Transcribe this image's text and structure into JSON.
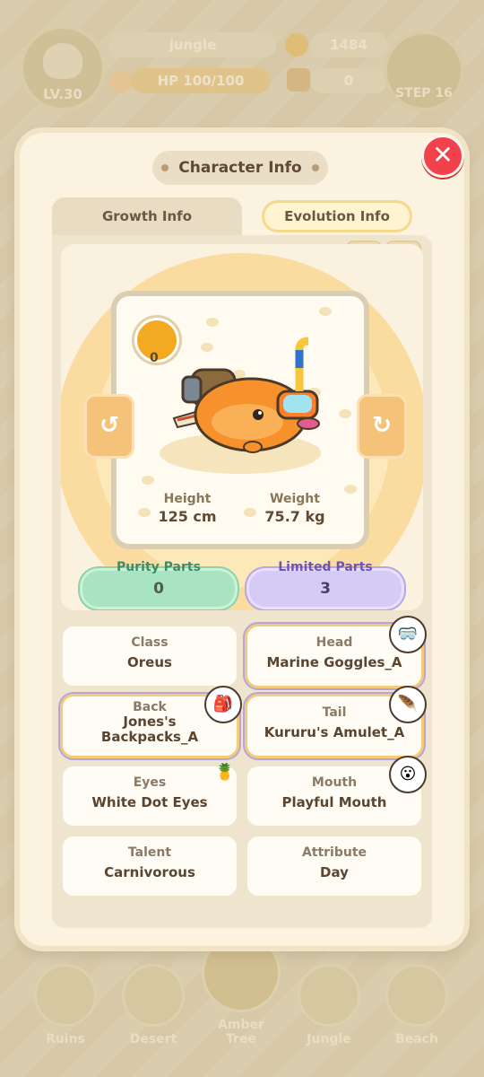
{
  "hud": {
    "level": "LV.30",
    "area": "jungle",
    "coins": "1484",
    "hp": "HP 100/100",
    "tickets": "0",
    "step": "STEP 16"
  },
  "modal": {
    "title": "Character Info",
    "close_icon": "close-icon",
    "tabs": {
      "growth": "Growth Info",
      "evolution": "Evolution Info"
    },
    "buffs": [
      "meat-icon",
      "sun-icon"
    ],
    "character": {
      "orange_count": "0",
      "height_label": "Height",
      "height_value": "125 cm",
      "weight_label": "Weight",
      "weight_value": "75.7 kg"
    },
    "parts": {
      "purity_label": "Purity Parts",
      "purity_value": "0",
      "limited_label": "Limited Parts",
      "limited_value": "3"
    },
    "attributes": [
      {
        "key": "Class",
        "value": "Oreus"
      },
      {
        "key": "Head",
        "value": "Marine Goggles_A"
      },
      {
        "key": "Back",
        "value": "Jones's Backpacks_A"
      },
      {
        "key": "Tail",
        "value": "Kururu's Amulet_A"
      },
      {
        "key": "Eyes",
        "value": "White Dot Eyes"
      },
      {
        "key": "Mouth",
        "value": "Playful Mouth"
      },
      {
        "key": "Talent",
        "value": "Carnivorous"
      },
      {
        "key": "Attribute",
        "value": "Day"
      }
    ]
  },
  "nav": [
    {
      "label": "Ruins"
    },
    {
      "label": "Desert"
    },
    {
      "label": "Amber Tree"
    },
    {
      "label": "Jungle"
    },
    {
      "label": "Beach"
    }
  ],
  "colors": {
    "accent_red": "#f1424c",
    "purity_green": "#a8e3c2",
    "limited_purple": "#d6caf6",
    "highlight_gold": "#f4cc75"
  }
}
